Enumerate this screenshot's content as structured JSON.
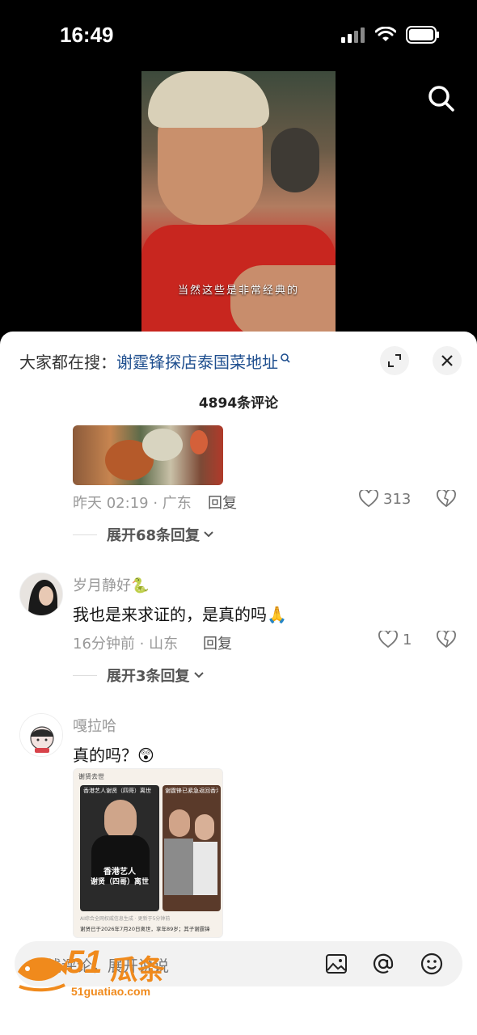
{
  "status_bar": {
    "time": "16:49"
  },
  "video": {
    "subtitle": "当然这些是非常经典的"
  },
  "sheet": {
    "search_prefix": "大家都在搜：",
    "search_term": "谢霆锋探店泰国菜地址",
    "comment_count": "4894条评论"
  },
  "comments": [
    {
      "time_location": "昨天 02:19 · 广东",
      "reply_label": "回复",
      "likes": "313",
      "expand_label": "展开68条回复"
    },
    {
      "username": "岁月静好🐍",
      "text": "我也是来求证的，是真的吗🙏",
      "time_location": "16分钟前 · 山东",
      "reply_label": "回复",
      "likes": "1",
      "expand_label": "展开3条回复"
    },
    {
      "username": "嘎拉哈",
      "text": "真的吗？😲",
      "news_image": {
        "header": "谢贤去世",
        "card1_title": "香港艺人谢贤（四哥）离世",
        "card1_caption": "香港艺人",
        "card1_name": "谢贤（四哥）离世",
        "card2_title": "谢霆锋已紧急返回香港",
        "ai_note": "AI综合全网权威信息生成 · 更新于5分钟前",
        "body": "谢贤已于2026年7月20日离世，享年89岁；其子谢霆锋"
      }
    }
  ],
  "input": {
    "placeholder": "在线评论，展开说说"
  },
  "watermark": {
    "brand": "51瓜条",
    "num": "51",
    "text": "瓜条",
    "url": "51guatiao.com"
  },
  "colors": {
    "search_term": "#1f4f8f",
    "watermark": "#f08a1c"
  }
}
